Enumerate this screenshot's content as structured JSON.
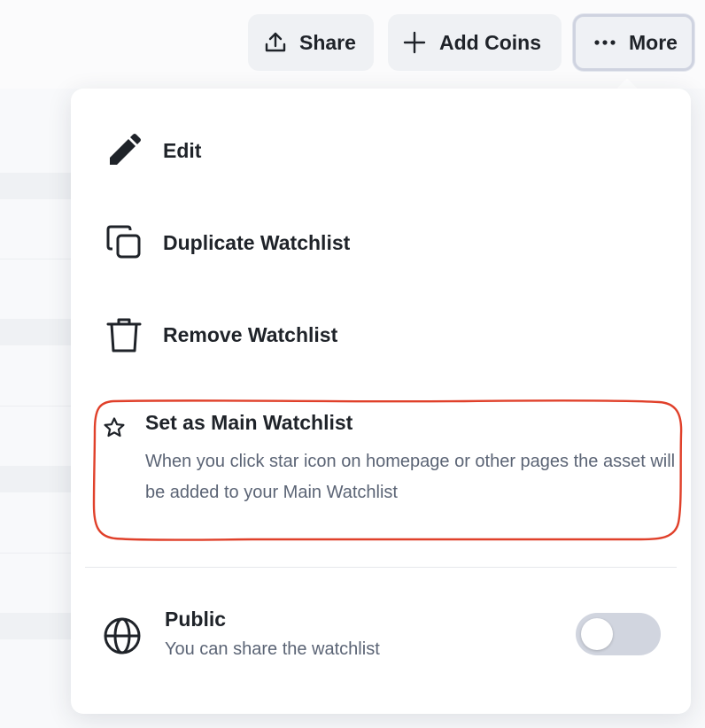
{
  "toolbar": {
    "share_label": "Share",
    "add_coins_label": "Add Coins",
    "more_label": "More"
  },
  "menu": {
    "edit_label": "Edit",
    "duplicate_label": "Duplicate Watchlist",
    "remove_label": "Remove Watchlist",
    "main_watchlist": {
      "title": "Set as Main Watchlist",
      "description": "When you click star icon on homepage or other pages the asset will be added to your Main Watchlist"
    },
    "public": {
      "title": "Public",
      "description": "You can share the watchlist",
      "enabled": false
    }
  },
  "icons": {
    "share": "share-upload-icon",
    "add": "plus-icon",
    "more": "ellipsis-icon",
    "edit": "pencil-icon",
    "duplicate": "copy-icon",
    "remove": "trash-icon",
    "main": "star-icon",
    "public": "globe-icon"
  },
  "colors": {
    "highlight": "#e0402a",
    "toggle_off": "#d1d5df",
    "text": "#1f2329",
    "muted": "#5b6475"
  }
}
